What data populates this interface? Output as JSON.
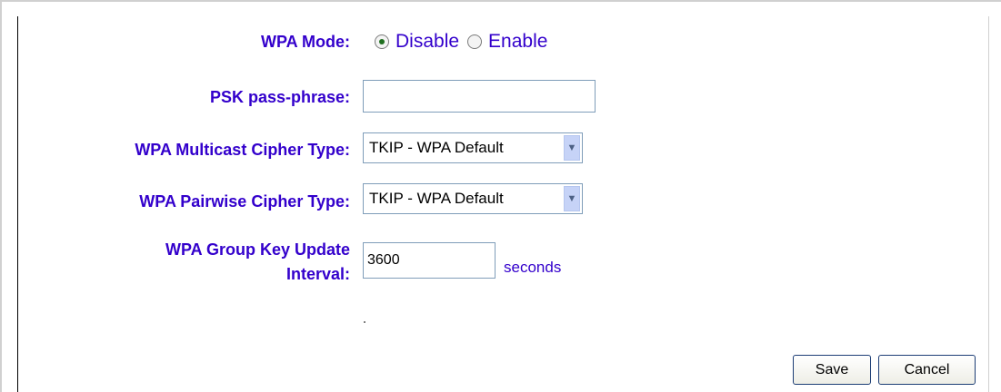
{
  "form": {
    "wpa_mode": {
      "label": "WPA Mode:",
      "options": [
        {
          "label": "Disable",
          "selected": true
        },
        {
          "label": "Enable",
          "selected": false
        }
      ]
    },
    "psk": {
      "label": "PSK pass-phrase:",
      "value": ""
    },
    "multicast_cipher": {
      "label": "WPA Multicast Cipher Type:",
      "value": "TKIP - WPA Default"
    },
    "pairwise_cipher": {
      "label": "WPA Pairwise Cipher Type:",
      "value": "TKIP - WPA Default"
    },
    "group_key": {
      "label_line1": "WPA Group Key Update",
      "label_line2": "Interval:",
      "value": "3600",
      "unit": "seconds"
    }
  },
  "buttons": {
    "save": "Save",
    "cancel": "Cancel"
  },
  "colors": {
    "label": "#3300cc",
    "arrow_bg": "#c6d3f7",
    "input_border": "#7f9db9"
  }
}
